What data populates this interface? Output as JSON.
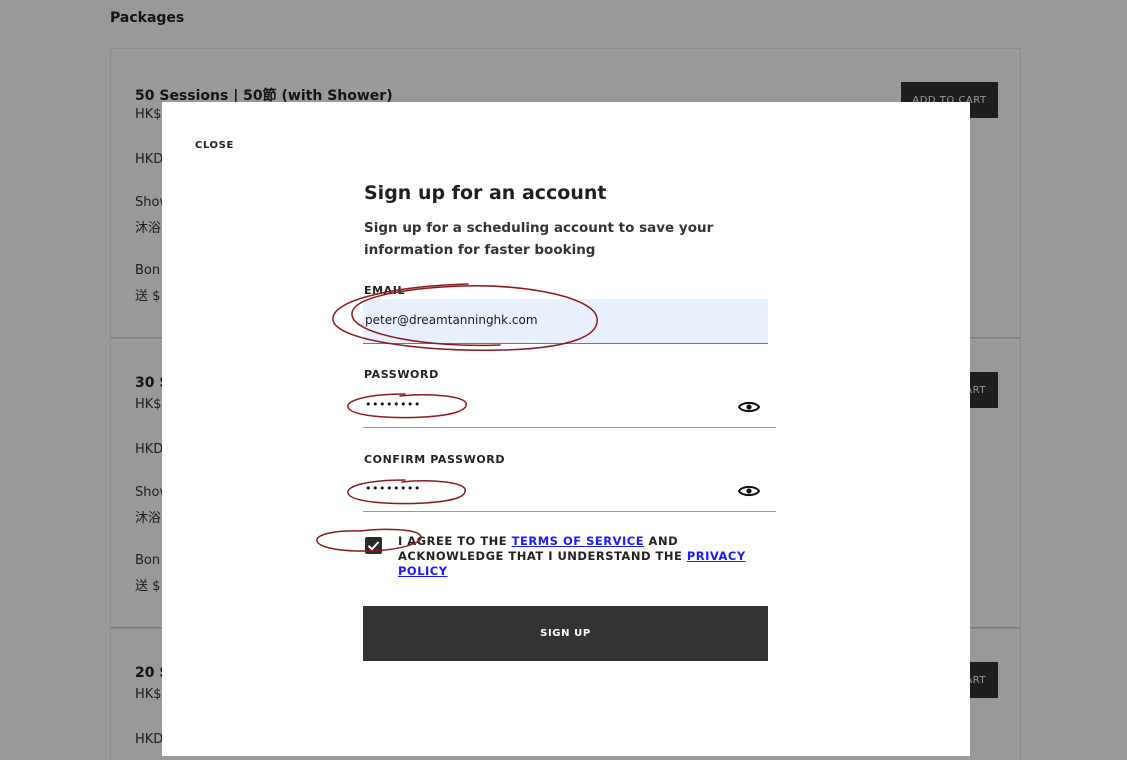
{
  "background": {
    "heading": "Packages",
    "packages": [
      {
        "title": "50 Sessions | 50節 (with Shower)",
        "lines": [
          "HK$",
          "HKD",
          "Show",
          "沐浴",
          "Bon",
          "送 $"
        ],
        "button": "ADD TO CART"
      },
      {
        "title": "30 S",
        "lines": [
          "HK$",
          "HKD",
          "Show",
          "沐浴",
          "Bon",
          "送 $"
        ],
        "button": "ART"
      },
      {
        "title": "20 S",
        "lines": [
          "HK$",
          "HKD"
        ],
        "button": "ART"
      }
    ]
  },
  "modal": {
    "close_label": "CLOSE",
    "title": "Sign up for an account",
    "subtitle": "Sign up for a scheduling account to save your information for faster booking",
    "email": {
      "label": "EMAIL",
      "value": "peter@dreamtanninghk.com"
    },
    "password": {
      "label": "PASSWORD",
      "value": "••••••••",
      "toggle_icon": "eye-icon"
    },
    "confirm_password": {
      "label": "CONFIRM PASSWORD",
      "value": "••••••••",
      "toggle_icon": "eye-icon"
    },
    "agreement": {
      "checked": true,
      "text_before": "I agree to the ",
      "terms_link": "Terms of Service",
      "text_middle": " and acknowledge that I understand the ",
      "privacy_link": "Privacy Policy"
    },
    "signup_button": "SIGN UP"
  },
  "colors": {
    "overlay": "#000000",
    "button_dark": "#333333",
    "autofill": "#e8f0fe",
    "link": "#1a1aff",
    "annotation": "#8b1a1a"
  }
}
